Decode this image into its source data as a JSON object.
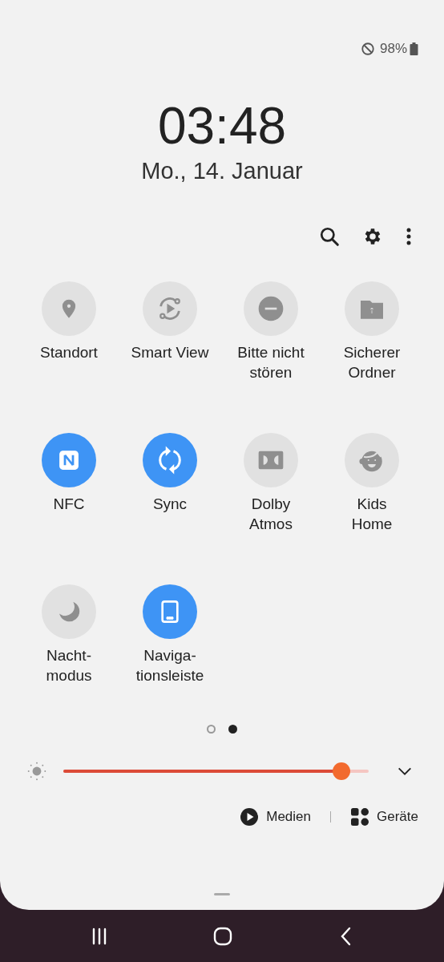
{
  "status_bar": {
    "battery": "98%"
  },
  "clock": {
    "time": "03:48",
    "date": "Mo., 14. Januar"
  },
  "tiles": [
    {
      "label": "Standort",
      "on": false
    },
    {
      "label": "Smart View",
      "on": false
    },
    {
      "label": "Bitte nicht\nstören",
      "on": false
    },
    {
      "label": "Sicherer\nOrdner",
      "on": false
    },
    {
      "label": "NFC",
      "on": true
    },
    {
      "label": "Sync",
      "on": true
    },
    {
      "label": "Dolby\nAtmos",
      "on": false
    },
    {
      "label": "Kids\nHome",
      "on": false
    },
    {
      "label": "Nacht-\nmodus",
      "on": false
    },
    {
      "label": "Naviga-\ntionsleiste",
      "on": true
    }
  ],
  "pages": [
    {
      "selected": false
    },
    {
      "selected": true
    }
  ],
  "brightness": {
    "level": 0.91
  },
  "links": [
    {
      "label": "Medien"
    },
    {
      "label": "Geräte"
    }
  ]
}
